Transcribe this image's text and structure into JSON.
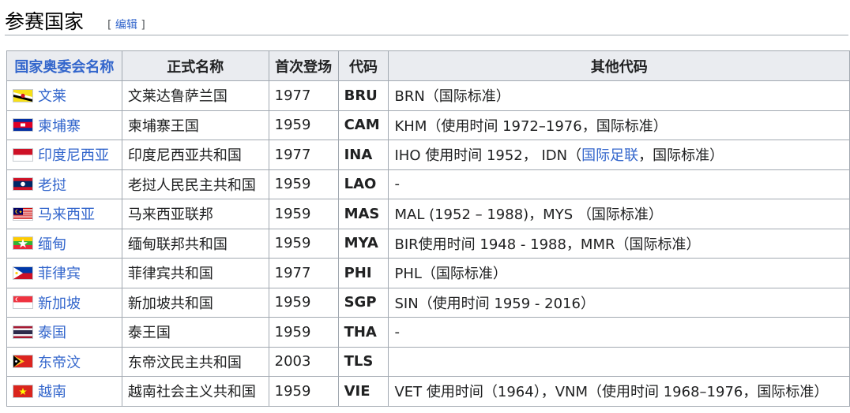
{
  "heading": {
    "title": "参赛国家",
    "edit_open": "[ ",
    "edit_label": "编辑",
    "edit_close": " ]"
  },
  "columns": [
    "国家奥委会名称",
    "正式名称",
    "首次登场",
    "代码",
    "其他代码"
  ],
  "rows": [
    {
      "name": "文莱",
      "official": "文莱达鲁萨兰国",
      "year": "1977",
      "code": "BRU",
      "other": "BRN（国际标准）",
      "flag": "brunei"
    },
    {
      "name": "柬埔寨",
      "official": "柬埔寨王国",
      "year": "1959",
      "code": "CAM",
      "other": "KHM（使用时间 1972–1976，国际标准）",
      "flag": "cambodia"
    },
    {
      "name": "印度尼西亚",
      "official": "印度尼西亚共和国",
      "year": "1977",
      "code": "INA",
      "other_a": "IHO 使用时间 1952， IDN（",
      "other_link": "国际足联",
      "other_b": "，国际标准）",
      "flag": "indonesia"
    },
    {
      "name": "老挝",
      "official": "老挝人民民主共和国",
      "year": "1959",
      "code": "LAO",
      "other": "-",
      "flag": "laos"
    },
    {
      "name": "马来西亚",
      "official": "马来西亚联邦",
      "year": "1959",
      "code": "MAS",
      "other": "MAL (1952 – 1988)，MYS （国际标准）",
      "flag": "malaysia"
    },
    {
      "name": "缅甸",
      "official": "缅甸联邦共和国",
      "year": "1959",
      "code": "MYA",
      "other": "BIR使用时间 1948 - 1988，MMR（国际标准）",
      "flag": "myanmar"
    },
    {
      "name": "菲律宾",
      "official": "菲律宾共和国",
      "year": "1977",
      "code": "PHI",
      "other": "PHL（国际标准）",
      "flag": "philippines"
    },
    {
      "name": "新加坡",
      "official": "新加坡共和国",
      "year": "1959",
      "code": "SGP",
      "other": "SIN（使用时间 1959 - 2016）",
      "flag": "singapore"
    },
    {
      "name": "泰国",
      "official": "泰王国",
      "year": "1959",
      "code": "THA",
      "other": "-",
      "flag": "thailand"
    },
    {
      "name": "东帝汶",
      "official": "东帝汶民主共和国",
      "year": "2003",
      "code": "TLS",
      "other": "",
      "flag": "timor-leste"
    },
    {
      "name": "越南",
      "official": "越南社会主义共和国",
      "year": "1959",
      "code": "VIE",
      "other": "VET 使用时间（1964），VNM（使用时间 1968–1976，国际标准）",
      "flag": "vietnam"
    }
  ]
}
